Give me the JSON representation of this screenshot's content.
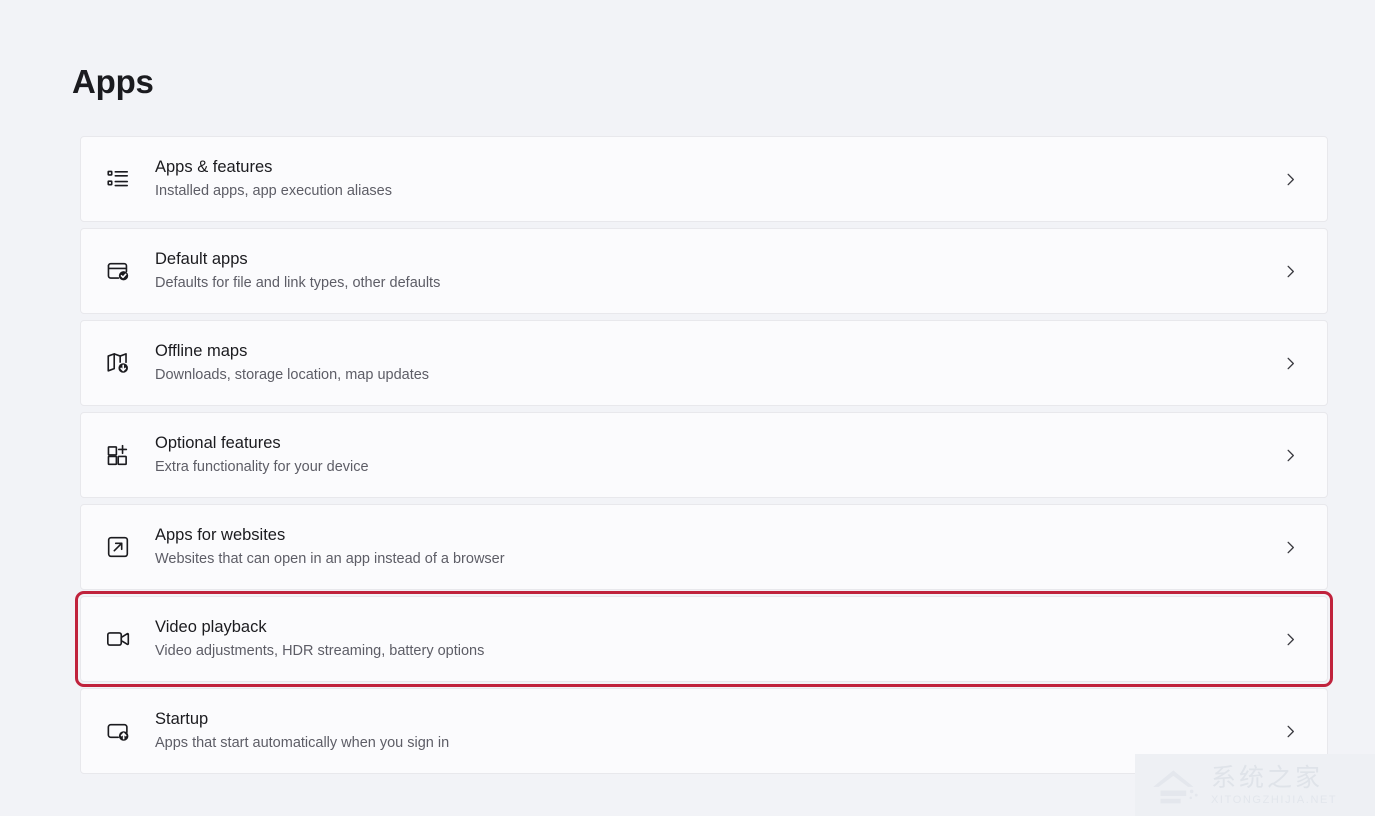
{
  "page": {
    "title": "Apps",
    "background_color": "#f2f3f7",
    "highlight_color": "#c0223c"
  },
  "settings": {
    "items": [
      {
        "icon": "list-bullet-icon",
        "title": "Apps & features",
        "subtitle": "Installed apps, app execution aliases",
        "chevron": "chevron-right-icon",
        "highlighted": false
      },
      {
        "icon": "window-check-icon",
        "title": "Default apps",
        "subtitle": "Defaults for file and link types, other defaults",
        "chevron": "chevron-right-icon",
        "highlighted": false
      },
      {
        "icon": "map-download-icon",
        "title": "Offline maps",
        "subtitle": "Downloads, storage location, map updates",
        "chevron": "chevron-right-icon",
        "highlighted": false
      },
      {
        "icon": "grid-plus-icon",
        "title": "Optional features",
        "subtitle": "Extra functionality for your device",
        "chevron": "chevron-right-icon",
        "highlighted": false
      },
      {
        "icon": "external-link-icon",
        "title": "Apps for websites",
        "subtitle": "Websites that can open in an app instead of a browser",
        "chevron": "chevron-right-icon",
        "highlighted": false
      },
      {
        "icon": "video-camera-icon",
        "title": "Video playback",
        "subtitle": "Video adjustments, HDR streaming, battery options",
        "chevron": "chevron-right-icon",
        "highlighted": true
      },
      {
        "icon": "window-arrow-up-icon",
        "title": "Startup",
        "subtitle": "Apps that start automatically when you sign in",
        "chevron": "chevron-right-icon",
        "highlighted": false
      }
    ]
  },
  "watermark": {
    "chinese": "系统之家",
    "english": "XITONGZHIJIA.NET"
  }
}
